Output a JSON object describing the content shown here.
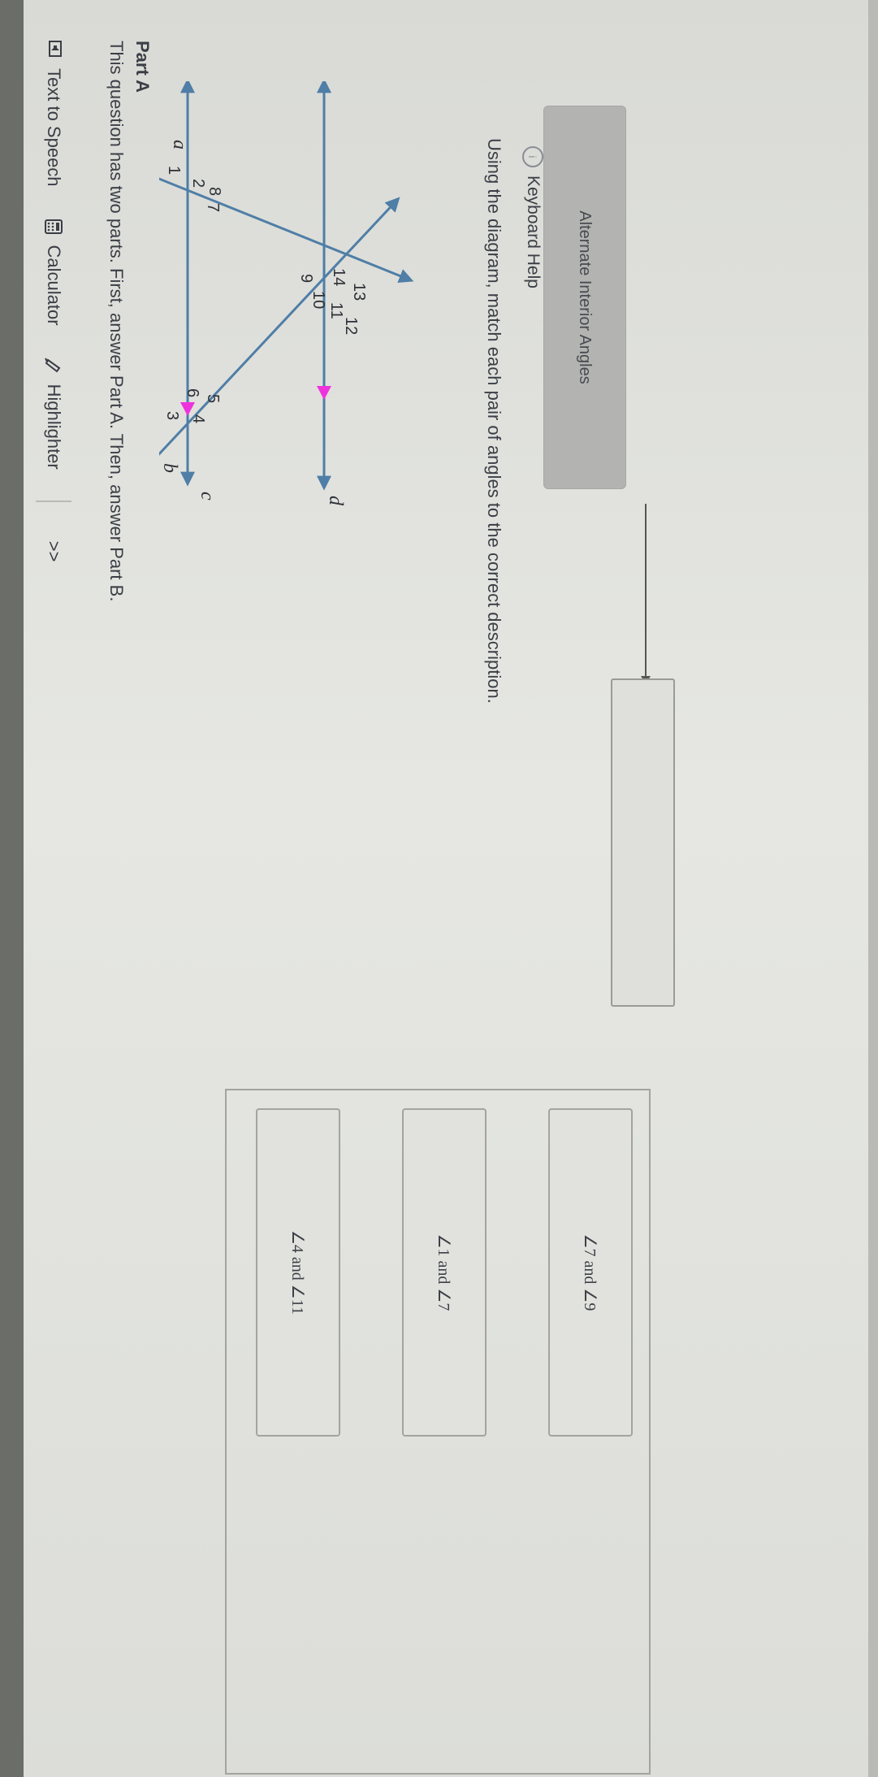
{
  "toolbar": {
    "text_to_speech": "Text to Speech",
    "calculator": "Calculator",
    "highlighter": "Highlighter",
    "more": ">>"
  },
  "intro": "This question has two parts. First, answer Part A. Then, answer Part B.",
  "part_label": "Part A",
  "diagram": {
    "line_labels": [
      "a",
      "b",
      "c",
      "d"
    ],
    "angle_labels": [
      "1",
      "2",
      "3",
      "4",
      "5",
      "6",
      "7",
      "8",
      "9",
      "10",
      "11",
      "12",
      "13",
      "14"
    ],
    "colors": {
      "line": "#4f7ea6",
      "accent": "#ee33dd"
    }
  },
  "prompt": "Using the diagram, match each pair of angles to the correct description.",
  "keyboard_help": "Keyboard Help",
  "choices": [
    "Alternate Interior Angles"
  ],
  "answers": [
    "∠7 and ∠9",
    "∠1 and ∠7",
    "∠4 and ∠11"
  ]
}
